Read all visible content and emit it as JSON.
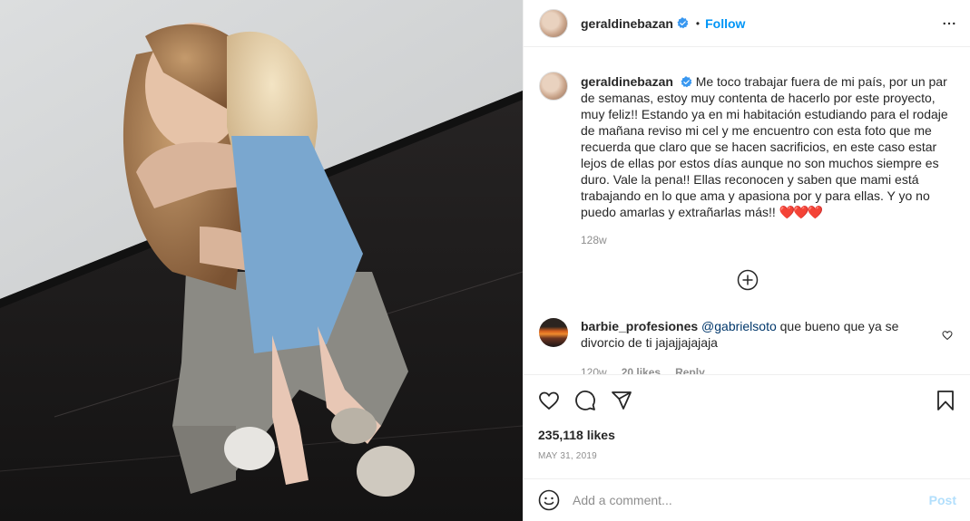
{
  "post": {
    "username": "geraldinebazan",
    "verified": true,
    "follow_label": "Follow",
    "separator": "•"
  },
  "caption": {
    "username": "geraldinebazan",
    "text": "Me toco trabajar fuera de mi país, por un par de semanas, estoy muy contenta de hacerlo por este proyecto, muy feliz!! Estando ya en mi habitación estudiando para el rodaje de mañana reviso mi cel y me encuentro con esta foto que me recuerda que claro que se hacen sacrificios, en este caso estar lejos de ellas por estos días aunque no son muchos siempre es duro. Vale la pena!! Ellas reconocen y saben que mami está trabajando en lo que ama y apasiona por y para ellas. Y yo no puedo amarlas y extrañarlas más!! ",
    "emoji": "❤️❤️❤️",
    "time_ago": "128w"
  },
  "comments": [
    {
      "username": "barbie_profesiones",
      "mention": "@gabrielsoto",
      "text": " que bueno que ya se divorcio de ti jajajjajajaja",
      "time_ago": "120w",
      "likes": "20 likes",
      "reply_label": "Reply"
    }
  ],
  "stats": {
    "likes": "235,118 likes",
    "date": "MAY 31, 2019"
  },
  "add_comment": {
    "placeholder": "Add a comment...",
    "post_label": "Post"
  },
  "colors": {
    "accent": "#0095f6",
    "muted": "#8e8e8e",
    "post_disabled": "#b2dffc",
    "heart": "#ed1c24"
  },
  "icons": [
    "verified-icon",
    "more-options-icon",
    "load-more-icon",
    "heart-icon",
    "comment-icon",
    "share-icon",
    "bookmark-icon",
    "emoji-icon"
  ]
}
